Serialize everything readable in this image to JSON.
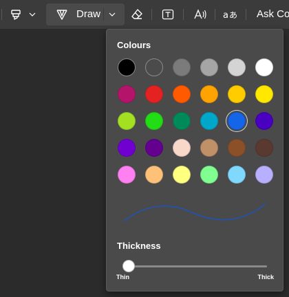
{
  "toolbar": {
    "draw_label": "Draw",
    "ask_label": "Ask Cop",
    "icons": [
      "highlighter-icon",
      "chevron-down-icon",
      "pen-icon",
      "chevron-down-icon",
      "eraser-icon",
      "text-box-icon",
      "read-aloud-icon",
      "translate-icon"
    ]
  },
  "panel": {
    "colours_title": "Colours",
    "thickness_title": "Thickness",
    "thin_label": "Thin",
    "thick_label": "Thick",
    "thickness_value": 0.0,
    "selected_colour": "#1565e8",
    "preview_stroke_colour": "#1f53b5",
    "swatches": [
      [
        "#000000",
        "#4b4b4b",
        "#7b7b7b",
        "#a5a5a5",
        "#d4d4d4",
        "#ffffff"
      ],
      [
        "#b4156a",
        "#e52222",
        "#ff5a00",
        "#ffa300",
        "#ffcc00",
        "#ffe800"
      ],
      [
        "#a3e022",
        "#22dd16",
        "#008a5a",
        "#00a7c8",
        "#1565e8",
        "#4a00c0"
      ],
      [
        "#7000d0",
        "#640090",
        "#f8d8c8",
        "#c09068",
        "#8c5028",
        "#5a3a30"
      ],
      [
        "#ff80f0",
        "#ffc078",
        "#ffff80",
        "#80ff90",
        "#80d8ff",
        "#b8b0ff"
      ]
    ]
  }
}
